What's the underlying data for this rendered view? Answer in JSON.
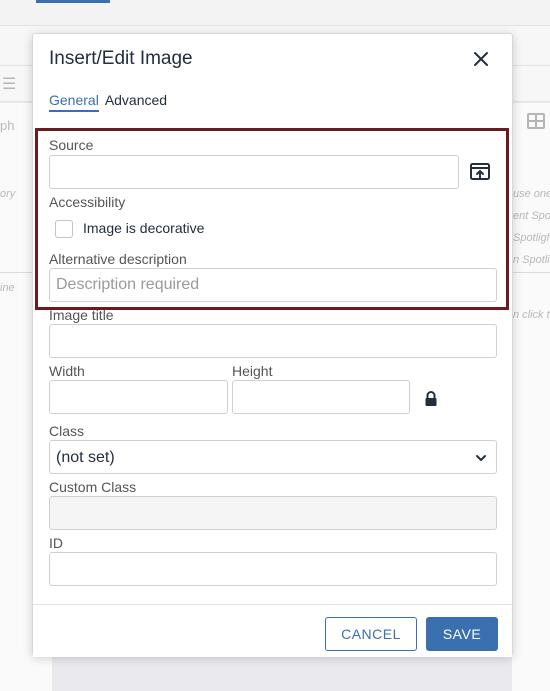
{
  "background": {
    "left_texts": [
      "ph",
      "ory",
      "ine"
    ],
    "right_texts": [
      "use one",
      "ent Spot",
      "Spotligh",
      "n Spotlig",
      "n click t"
    ]
  },
  "dialog": {
    "title": "Insert/Edit Image",
    "close_icon": "close-icon",
    "tabs": [
      {
        "label": "General",
        "active": true
      },
      {
        "label": "Advanced",
        "active": false
      }
    ],
    "source": {
      "label": "Source",
      "value": "",
      "browse_icon": "browse-upload-icon"
    },
    "accessibility": {
      "label": "Accessibility",
      "decorative_label": "Image is decorative",
      "decorative_checked": false
    },
    "alt": {
      "label": "Alternative description",
      "placeholder": "Description required",
      "value": ""
    },
    "image_title": {
      "label": "Image title",
      "value": ""
    },
    "width": {
      "label": "Width",
      "value": ""
    },
    "height": {
      "label": "Height",
      "value": ""
    },
    "lock_icon": "lock-icon",
    "class": {
      "label": "Class",
      "selected": "(not set)"
    },
    "custom_class": {
      "label": "Custom Class",
      "value": ""
    },
    "id": {
      "label": "ID",
      "value": ""
    },
    "buttons": {
      "cancel": "CANCEL",
      "save": "SAVE"
    }
  },
  "colors": {
    "accent": "#3a6fb0",
    "highlight_border": "#6b1a22"
  }
}
